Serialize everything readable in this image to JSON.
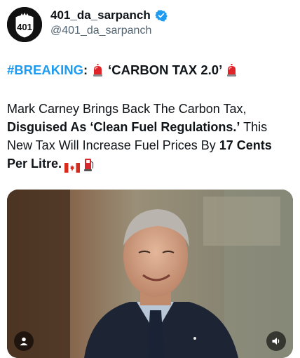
{
  "author": {
    "display_name": "401_da_sarpanch",
    "handle": "@401_da_sarpanch",
    "avatar_text": "401",
    "verified": true
  },
  "tweet": {
    "hashtag": "#BREAKING",
    "headline_sep": ":",
    "headline": "‘CARBON TAX 2.0’",
    "body": {
      "part1": "Mark Carney Brings Back The Carbon Tax, ",
      "bold1": "Disguised As ‘Clean Fuel Regulations.’",
      "part2": " This New Tax Will Increase Fuel Prices By ",
      "bold2": "17 Cents Per Litre."
    }
  },
  "media": {
    "type": "photo"
  },
  "icons": {
    "verified": "verified-badge-icon",
    "siren": "rotating-light-icon",
    "flag": "canada-flag-icon",
    "fuel": "fuel-pump-icon",
    "user_tag": "person-icon",
    "mute": "speaker-icon"
  },
  "colors": {
    "link": "#1d9bf0",
    "text": "#0f1419",
    "secondary": "#536471"
  }
}
